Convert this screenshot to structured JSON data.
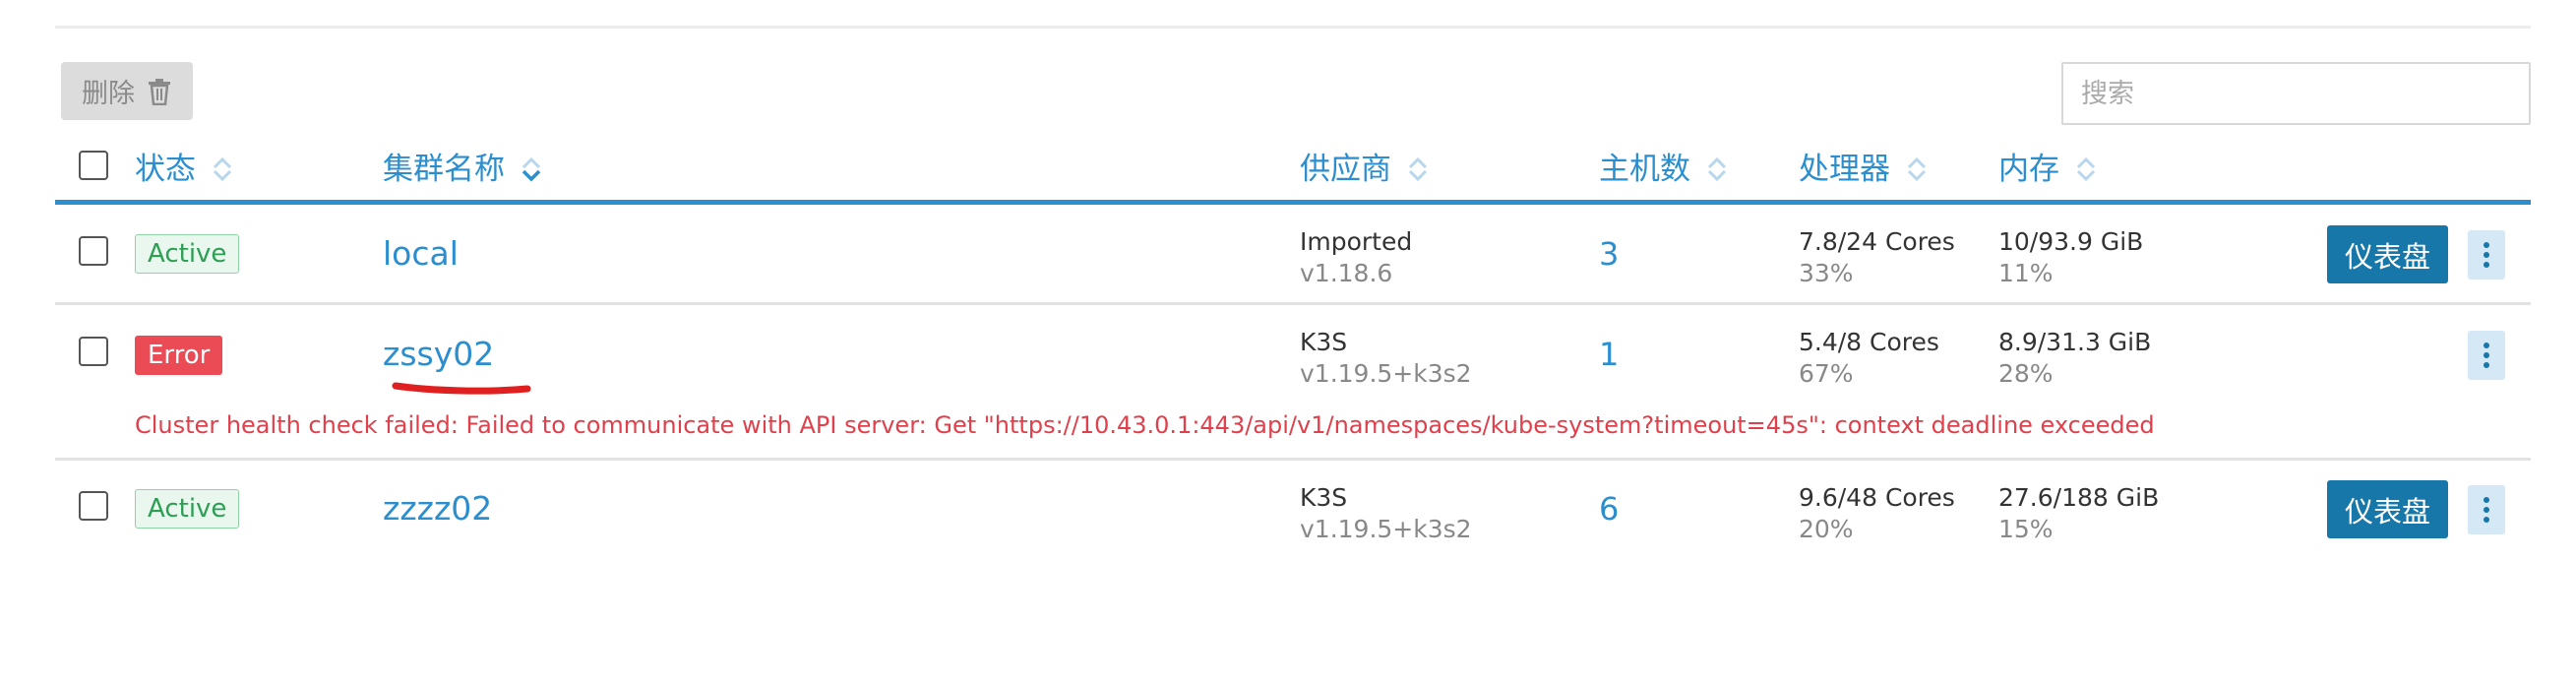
{
  "toolbar": {
    "delete_label": "删除",
    "search_placeholder": "搜索"
  },
  "table": {
    "headers": {
      "state": "状态",
      "name": "集群名称",
      "provider": "供应商",
      "hosts": "主机数",
      "cpu": "处理器",
      "memory": "内存"
    },
    "rows": [
      {
        "state": "Active",
        "name": "local",
        "provider": "Imported",
        "version": "v1.18.6",
        "hosts": "3",
        "cpu": "7.8/24 Cores",
        "cpu_pct": "33%",
        "mem": "10/93.9 GiB",
        "mem_pct": "11%",
        "dashboard_label": "仪表盘"
      },
      {
        "state": "Error",
        "name": "zssy02",
        "provider": "K3S",
        "version": "v1.19.5+k3s2",
        "hosts": "1",
        "cpu": "5.4/8 Cores",
        "cpu_pct": "67%",
        "mem": "8.9/31.3 GiB",
        "mem_pct": "28%",
        "error_message": "Cluster health check failed: Failed to communicate with API server: Get \"https://10.43.0.1:443/api/v1/namespaces/kube-system?timeout=45s\": context deadline exceeded"
      },
      {
        "state": "Active",
        "name": "zzzz02",
        "provider": "K3S",
        "version": "v1.19.5+k3s2",
        "hosts": "6",
        "cpu": "9.6/48 Cores",
        "cpu_pct": "20%",
        "mem": "27.6/188 GiB",
        "mem_pct": "15%",
        "dashboard_label": "仪表盘"
      }
    ]
  },
  "colors": {
    "accent": "#2b8ecf",
    "primary_button": "#1877a9",
    "error": "#ea4b55",
    "active": "#2d9f54",
    "annotation": "#e02020"
  }
}
